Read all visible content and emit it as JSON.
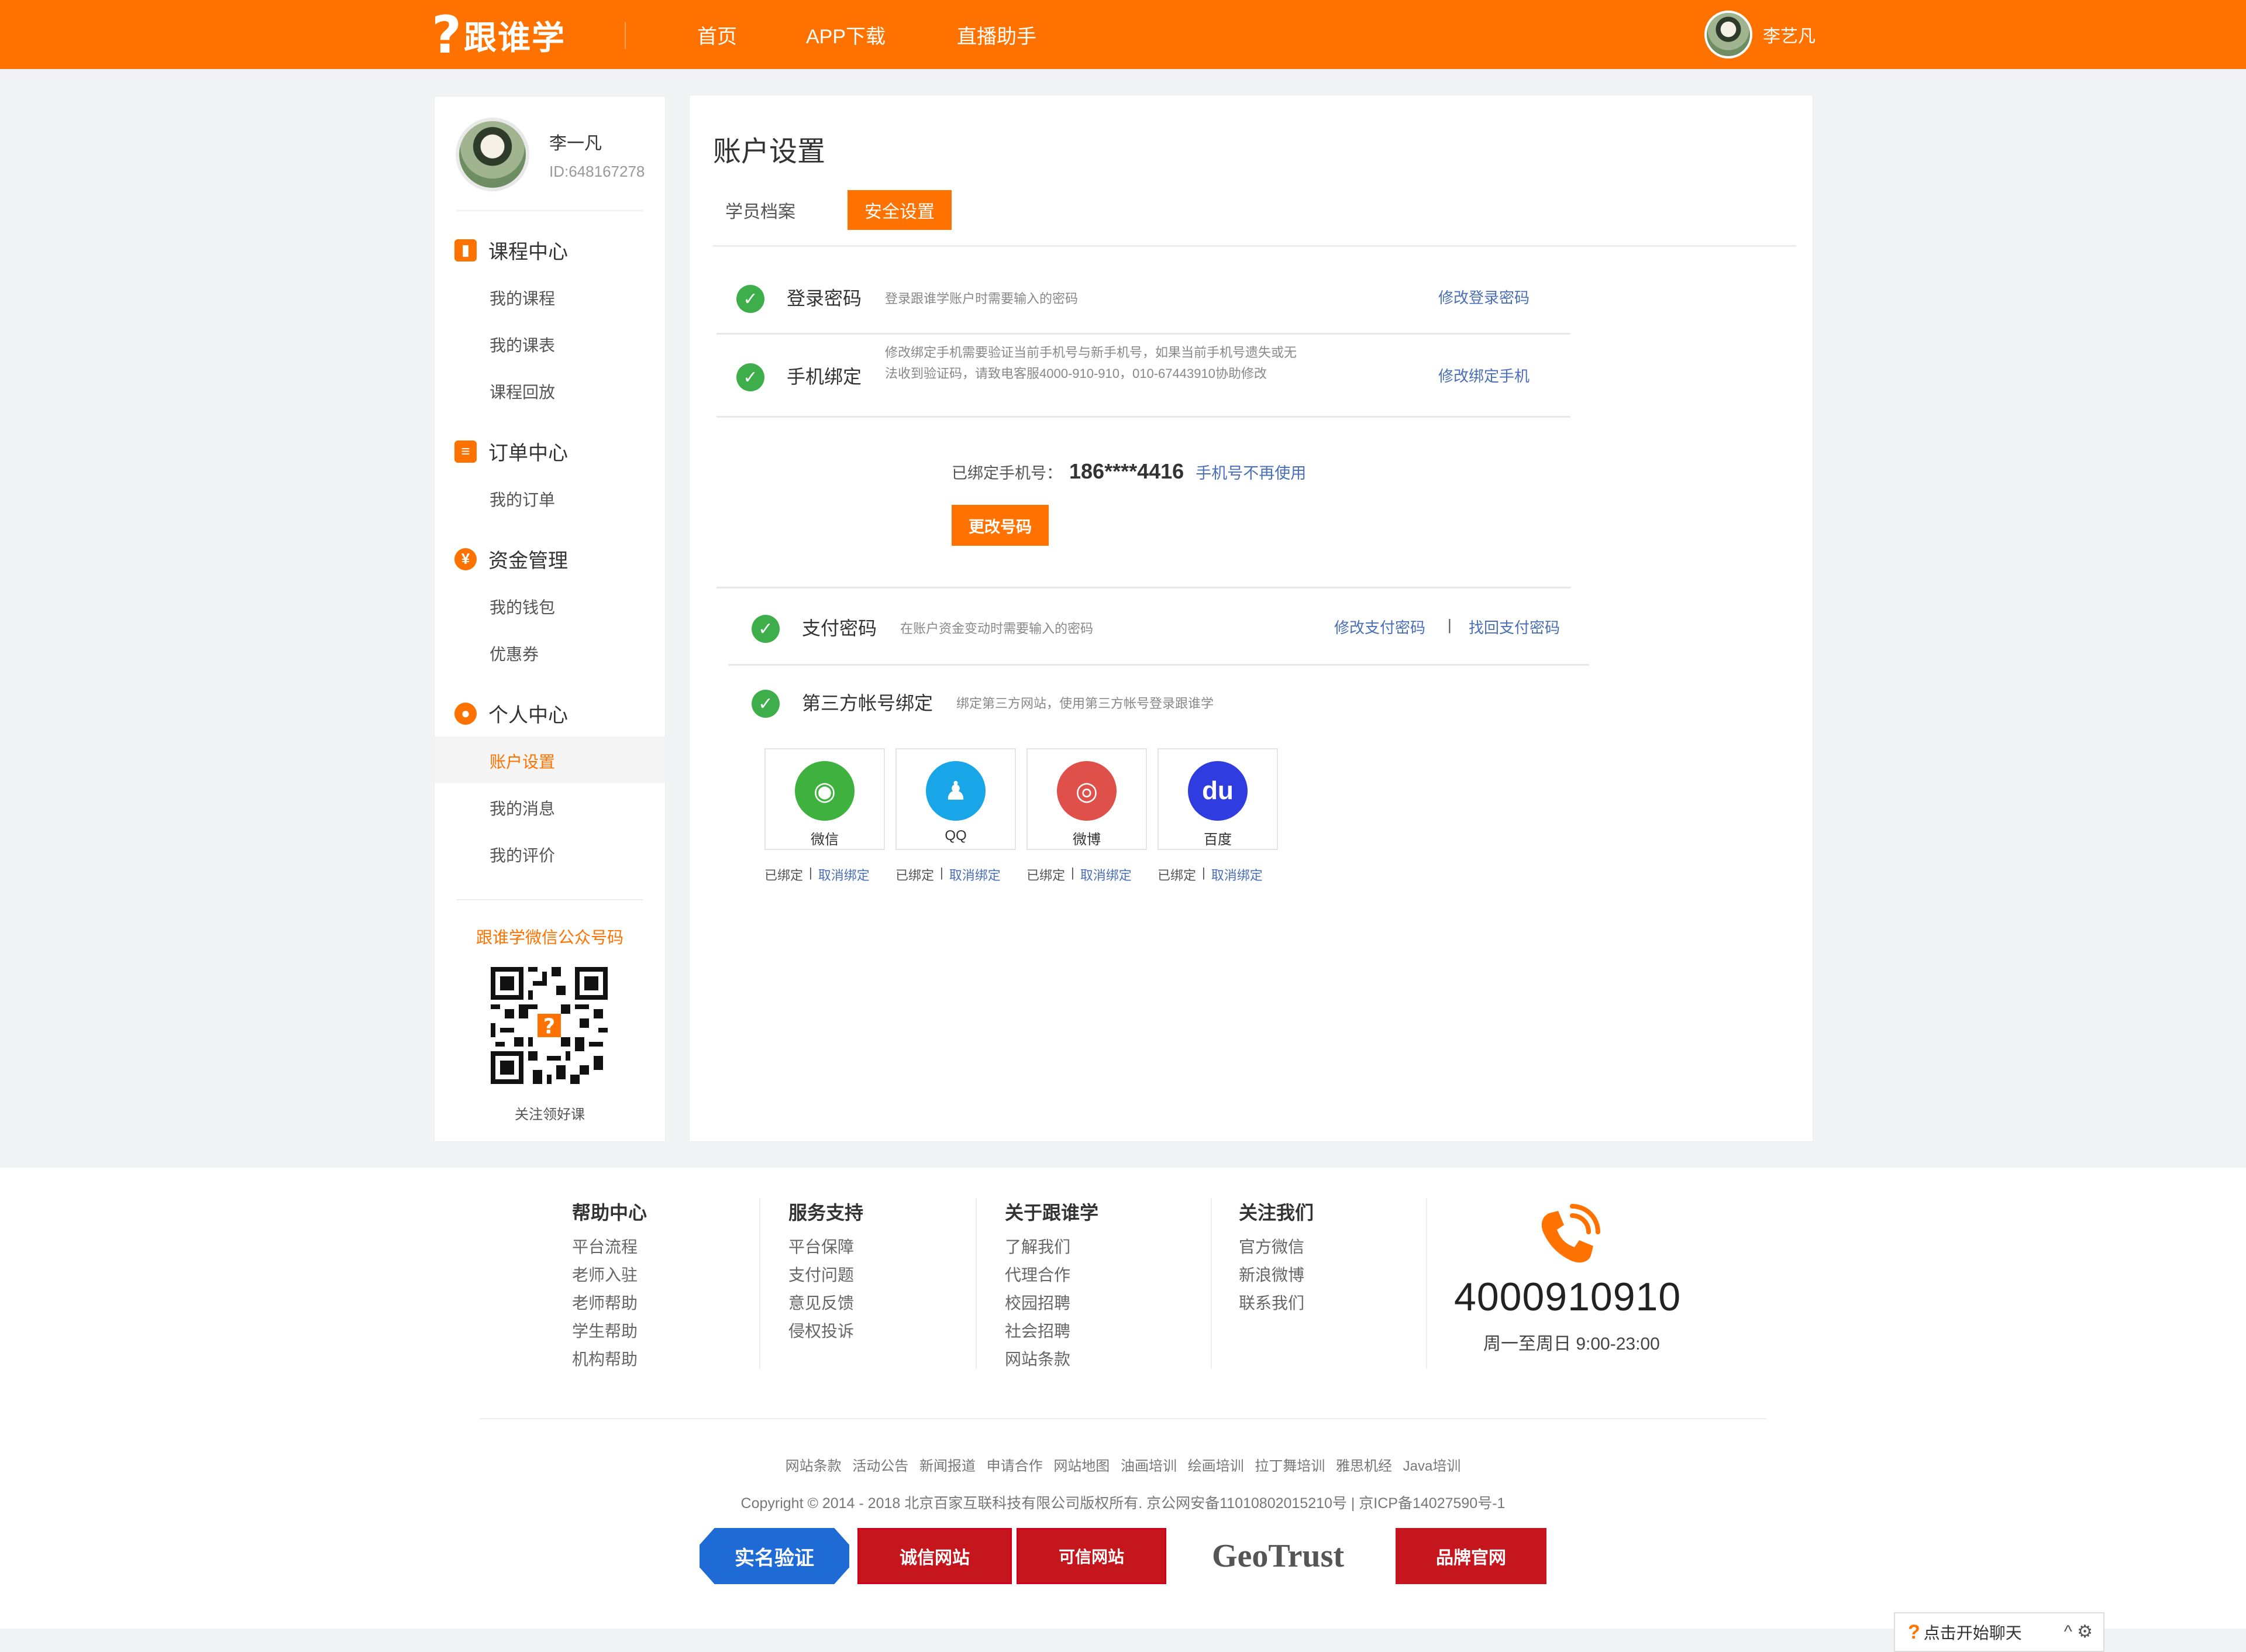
{
  "header": {
    "logo_text": "跟谁学",
    "nav": [
      "首页",
      "APP下载",
      "直播助手"
    ],
    "user_name": "李艺凡"
  },
  "sidebar": {
    "profile_name": "李一凡",
    "profile_id": "ID:648167278",
    "groups": [
      {
        "title": "课程中心",
        "icon": "book-icon",
        "items": [
          "我的课程",
          "我的课表",
          "课程回放"
        ]
      },
      {
        "title": "订单中心",
        "icon": "order-icon",
        "items": [
          "我的订单"
        ]
      },
      {
        "title": "资金管理",
        "icon": "yuan-icon",
        "items": [
          "我的钱包",
          "优惠券"
        ]
      },
      {
        "title": "个人中心",
        "icon": "user-icon",
        "items": [
          "账户设置",
          "我的消息",
          "我的评价"
        ]
      }
    ],
    "active_item": "账户设置",
    "qr_title": "跟谁学微信公众号码",
    "qr_caption": "关注领好课"
  },
  "main": {
    "title": "账户设置",
    "tabs": [
      "学员档案",
      "安全设置"
    ],
    "active_tab": "安全设置",
    "rows": {
      "login": {
        "label": "登录密码",
        "desc": "登录跟谁学账户时需要输入的密码",
        "link": "修改登录密码"
      },
      "phone": {
        "label": "手机绑定",
        "desc": "修改绑定手机需要验证当前手机号与新手机号，如果当前手机号遗失或无法收到验证码，请致电客服4000-910-910，010-67443910协助修改",
        "link": "修改绑定手机"
      },
      "pay": {
        "label": "支付密码",
        "desc": "在账户资金变动时需要输入的密码",
        "link_modify": "修改支付密码",
        "separator": "|",
        "link_recover": "找回支付密码"
      },
      "third": {
        "label": "第三方帐号绑定",
        "desc": "绑定第三方网站，使用第三方帐号登录跟谁学"
      }
    },
    "bound_phone": {
      "label": "已绑定手机号：",
      "number": "186****4416",
      "link": "手机号不再使用",
      "button": "更改号码"
    },
    "social": [
      {
        "name": "微信",
        "color": "#3eb13e",
        "icon": "wechat-icon",
        "status": "已绑定",
        "action": "取消绑定"
      },
      {
        "name": "QQ",
        "color": "#19a6e8",
        "icon": "qq-icon",
        "status": "已绑定",
        "action": "取消绑定"
      },
      {
        "name": "微博",
        "color": "#e0504a",
        "icon": "weibo-icon",
        "status": "已绑定",
        "action": "取消绑定"
      },
      {
        "name": "百度",
        "color": "#2f3de0",
        "icon": "baidu-icon",
        "status": "已绑定",
        "action": "取消绑定"
      }
    ],
    "separator": "|"
  },
  "footer": {
    "columns": [
      {
        "title": "帮助中心",
        "items": [
          "平台流程",
          "老师入驻",
          "老师帮助",
          "学生帮助",
          "机构帮助"
        ]
      },
      {
        "title": "服务支持",
        "items": [
          "平台保障",
          "支付问题",
          "意见反馈",
          "侵权投诉"
        ]
      },
      {
        "title": "关于跟谁学",
        "items": [
          "了解我们",
          "代理合作",
          "校园招聘",
          "社会招聘",
          "网站条款"
        ]
      },
      {
        "title": "关注我们",
        "items": [
          "官方微信",
          "新浪微博",
          "联系我们"
        ]
      }
    ],
    "hotline": "4000910910",
    "hours": "周一至周日 9:00-23:00",
    "links": [
      "网站条款",
      "活动公告",
      "新闻报道",
      "申请合作",
      "网站地图",
      "油画培训",
      "绘画培训",
      "拉丁舞培训",
      "雅思机经",
      "Java培训"
    ],
    "copyright": "Copyright © 2014 - 2018 北京百家互联科技有限公司版权所有. 京公网安备11010802015210号 | 京ICP备14027590号-1",
    "badges": [
      "实名验证",
      "诚信网站",
      "可信网站",
      "GeoTrust",
      "品牌官网"
    ]
  },
  "chat": {
    "label": "点击开始聊天",
    "controls": "^ ⚙"
  },
  "colors": {
    "brand": "#ff7200",
    "link": "#4a6fb8",
    "check": "#3eae4a"
  }
}
